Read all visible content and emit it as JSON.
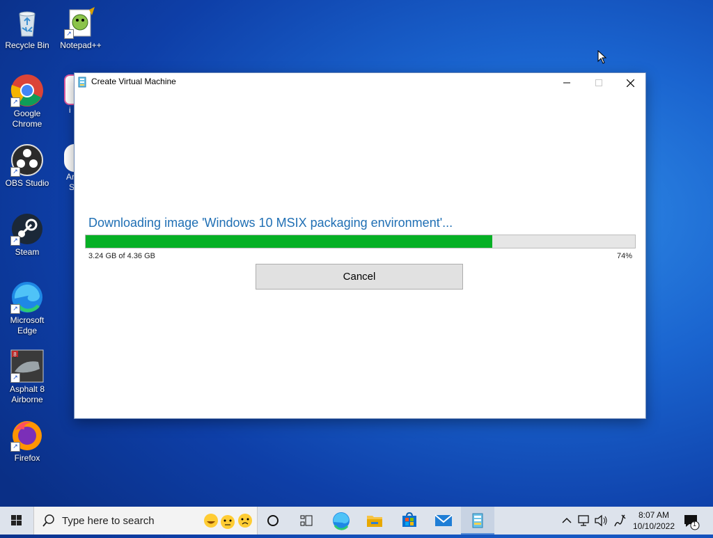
{
  "desktop": {
    "icons": [
      {
        "label": "Recycle Bin"
      },
      {
        "label": "Notepad++"
      },
      {
        "label": "Google Chrome"
      },
      {
        "label": "OBS Studio"
      },
      {
        "label": "Steam"
      },
      {
        "label": "Microsoft Edge"
      },
      {
        "label": "Asphalt 8 Airborne"
      },
      {
        "label": "Firefox"
      }
    ],
    "partial_labels": [
      "i",
      "Ar",
      "S"
    ]
  },
  "window": {
    "title": "Create Virtual Machine",
    "status_text": "Downloading image 'Windows 10 MSIX packaging environment'...",
    "progress": {
      "percent": 74,
      "percent_label": "74%",
      "size_label": "3.24 GB of 4.36 GB"
    },
    "cancel_label": "Cancel"
  },
  "taskbar": {
    "search_placeholder": "Type here to search",
    "clock_time": "8:07 AM",
    "clock_date": "10/10/2022",
    "notification_count": "1"
  },
  "colors": {
    "accent": "#1f6fb4",
    "progress_fill": "#06b025"
  }
}
